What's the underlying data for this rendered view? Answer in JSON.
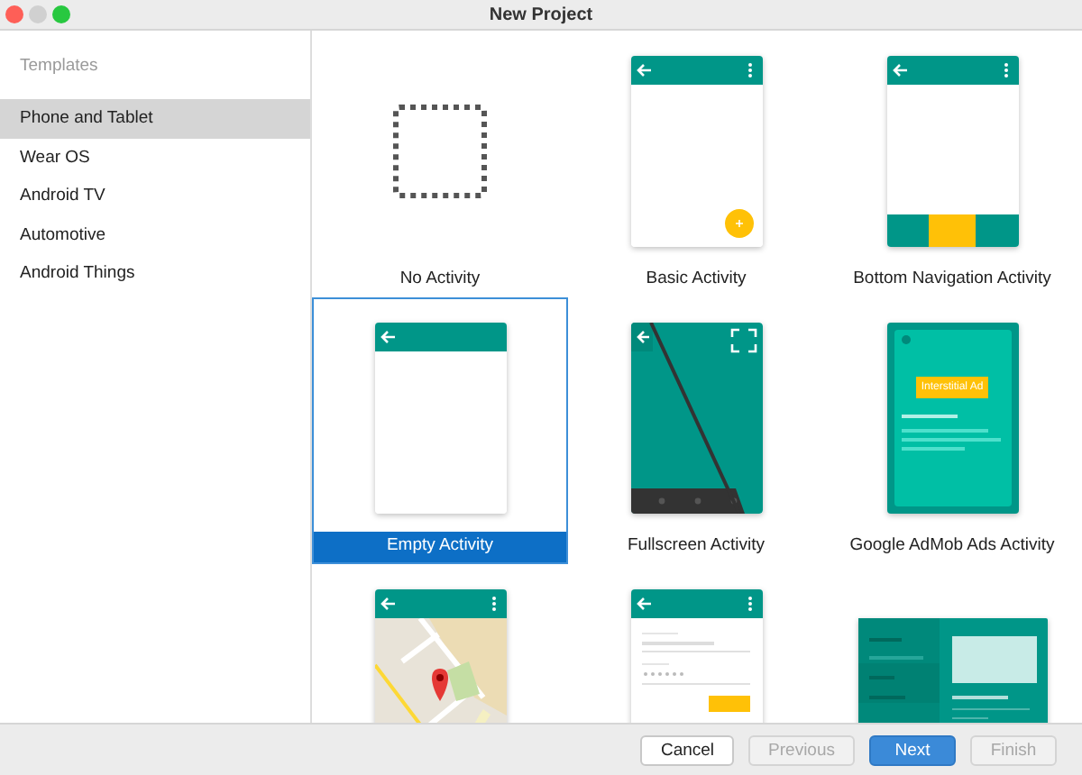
{
  "window": {
    "title": "New Project"
  },
  "sidebar": {
    "heading": "Templates",
    "items": [
      {
        "label": "Phone and Tablet",
        "selected": true
      },
      {
        "label": "Wear OS",
        "selected": false
      },
      {
        "label": "Android TV",
        "selected": false
      },
      {
        "label": "Automotive",
        "selected": false
      },
      {
        "label": "Android Things",
        "selected": false
      }
    ]
  },
  "templates": [
    {
      "kind": "no_activity",
      "label": "No Activity",
      "selected": false
    },
    {
      "kind": "basic",
      "label": "Basic Activity",
      "selected": false
    },
    {
      "kind": "bottom_nav",
      "label": "Bottom Navigation Activity",
      "selected": false
    },
    {
      "kind": "empty",
      "label": "Empty Activity",
      "selected": true
    },
    {
      "kind": "fullscreen",
      "label": "Fullscreen Activity",
      "selected": false
    },
    {
      "kind": "admob",
      "label": "Google AdMob Ads Activity",
      "ad_label": "Interstitial Ad",
      "selected": false
    },
    {
      "kind": "maps",
      "selected": false
    },
    {
      "kind": "login",
      "selected": false
    },
    {
      "kind": "master_detail",
      "selected": false
    }
  ],
  "buttons": [
    {
      "label": "Cancel",
      "kind": "default",
      "disabled": false
    },
    {
      "label": "Previous",
      "kind": "default",
      "disabled": true
    },
    {
      "label": "Next",
      "kind": "primary",
      "disabled": false
    },
    {
      "label": "Finish",
      "kind": "default",
      "disabled": true
    }
  ]
}
